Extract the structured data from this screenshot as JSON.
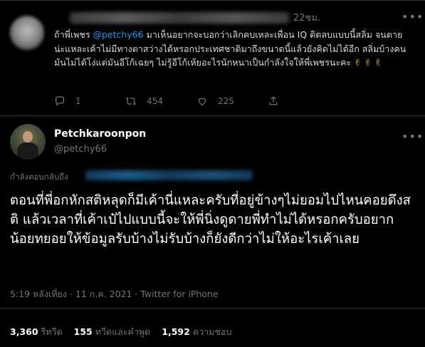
{
  "reply": {
    "time": "22ชม.",
    "text_prefix": "ถ้าพี่เพชร ",
    "mention": "@petchy66",
    "text_rest": " มาเห็นอยากจะบอกว่าเลิกคบเหละเพื่อน IQ ติดลบแบบนี้สลิ่ม จนตายน่ะแหละเค้าไม่มีทางตาสว่างได้หรอกประเทศชาติมาถึงขนาดนี้แล้วยังคิดไม่ได้อีก สลิ่มบ้างคนมันไม่ได้โง่แต่มันอีโก้เฉยๆ ไม่รู้อีโก้เห้ยอะไรนักหนาเป็นกำลังใจให้พี่เพชรนะคะ",
    "emojis": "✌ ✌ ✌",
    "replies_count": "1",
    "retweets_count": "454",
    "likes_count": "225"
  },
  "tweet": {
    "display_name": "Petchkaroonpon",
    "handle": "@petchy66",
    "replying_to_label": "กำลังตอบกลับถึง",
    "text": "ตอนที่พี่อกหักสติหลุดก็มีเค้านี่แหละครับที่อยู่ข้างๆไม่ยอมไปไหนคอยดึงสติ แล้วเวลาที่เค้าเป๋ไปแบบนี้จะให้พี่นิ่งดูดายพี่ทำไม่ได้หรอกครับอยากน้อยทยอยให้ข้อมูลรับบ้างไม่รับบ้างก็ยังดีกว่าไม่ให้อะไรเค้าเลย",
    "meta": "5:19 หลังเที่ยง · 11 ก.ค. 2021 · Twitter for iPhone"
  },
  "stats": {
    "retweets_value": "3,360",
    "retweets_label": "รีทวีต",
    "quotes_value": "155",
    "quotes_label": "ทวีตและคำพูด",
    "likes_value": "1,592",
    "likes_label": "ความชอบ"
  },
  "colors": {
    "background": "#000000",
    "mention": "#1d9bf0",
    "muted": "#6e767d"
  }
}
